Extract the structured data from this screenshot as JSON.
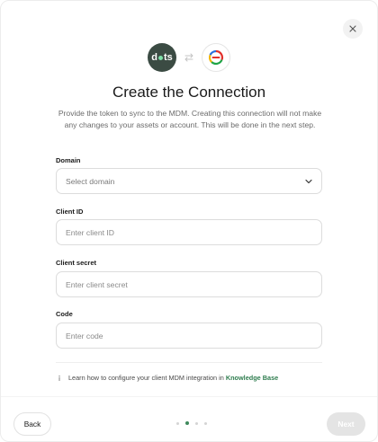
{
  "dialog": {
    "title": "Create the Connection",
    "description": "Provide the token to sync to the MDM. Creating this connection will not make any changes to your assets or account. This will be done in the next step.",
    "logo_left": "dots-logo",
    "logo_right": "mdm-provider-logo",
    "close_icon": "close-icon"
  },
  "form": {
    "domain": {
      "label": "Domain",
      "value": "Select domain",
      "icon": "chevron-down-icon"
    },
    "client_id": {
      "label": "Client ID",
      "placeholder": "Enter client ID",
      "value": ""
    },
    "client_secret": {
      "label": "Client secret",
      "placeholder": "Enter client secret",
      "value": ""
    },
    "code": {
      "label": "Code",
      "placeholder": "Enter code",
      "value": ""
    }
  },
  "info": {
    "icon": "info-icon",
    "text": "Learn how to configure your client MDM integration in",
    "link": "Knowledge Base"
  },
  "footer": {
    "back_label": "Back",
    "next_label": "Next",
    "steps_total": 4,
    "current_step": 2
  },
  "colors": {
    "accent": "#3f8a5c",
    "logo_bg": "#3b4b43",
    "link": "#2f7d4f",
    "disabled_button": "#e4e4e4"
  }
}
